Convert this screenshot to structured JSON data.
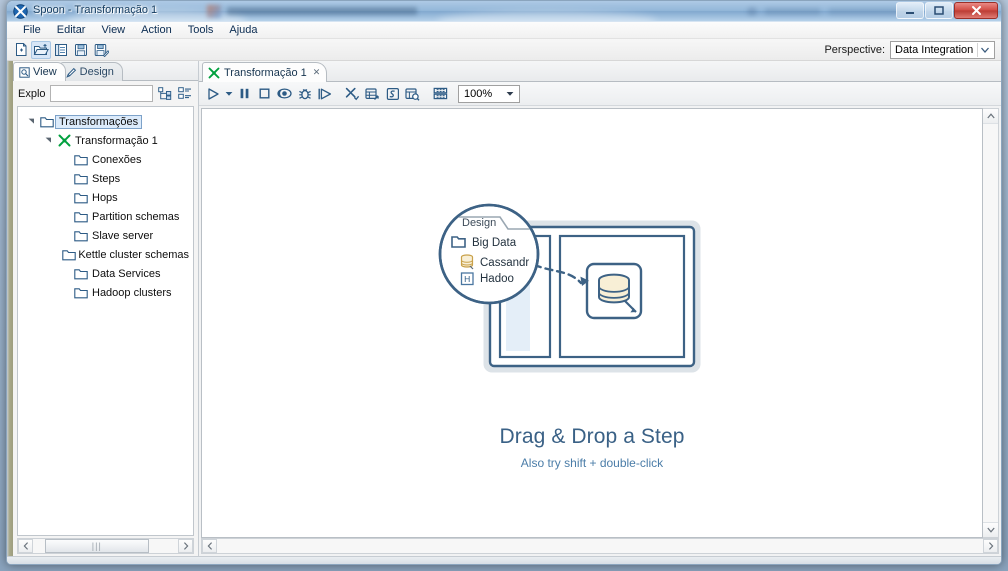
{
  "window": {
    "title": "Spoon - Transformação 1",
    "app_icon": "spoon-icon",
    "minimize_label": "Minimize",
    "maximize_label": "Maximize",
    "close_label": "Close"
  },
  "menubar": {
    "items": [
      {
        "label": "File",
        "name": "menu-file"
      },
      {
        "label": "Editar",
        "name": "menu-editar"
      },
      {
        "label": "View",
        "name": "menu-view"
      },
      {
        "label": "Action",
        "name": "menu-action"
      },
      {
        "label": "Tools",
        "name": "menu-tools"
      },
      {
        "label": "Ajuda",
        "name": "menu-ajuda"
      }
    ]
  },
  "toolbar": {
    "icons": [
      {
        "name": "new-file-icon",
        "title": "New"
      },
      {
        "name": "open-folder-icon",
        "title": "Open"
      },
      {
        "name": "list-icon",
        "title": "Explore"
      },
      {
        "name": "save-icon",
        "title": "Save"
      },
      {
        "name": "save-as-icon",
        "title": "Save as"
      }
    ],
    "perspective_label": "Perspective:",
    "perspective_value": "Data Integration"
  },
  "left_panel": {
    "tabs": [
      {
        "label": "View",
        "icon": "view-icon",
        "active": true
      },
      {
        "label": "Design",
        "icon": "pencil-icon",
        "active": false
      }
    ],
    "filter": {
      "label": "Explo",
      "value": "",
      "placeholder": "",
      "buttons": [
        {
          "name": "expand-all-icon"
        },
        {
          "name": "collapse-all-icon"
        }
      ]
    },
    "tree": [
      {
        "label": "Transformações",
        "depth": 0,
        "icon": "folder-icon",
        "twisty": "expanded",
        "selected": true
      },
      {
        "label": "Transformação 1",
        "depth": 1,
        "icon": "transformation-icon",
        "twisty": "expanded",
        "selected": false
      },
      {
        "label": "Conexões",
        "depth": 2,
        "icon": "folder-icon",
        "twisty": "none",
        "selected": false
      },
      {
        "label": "Steps",
        "depth": 2,
        "icon": "folder-icon",
        "twisty": "none",
        "selected": false
      },
      {
        "label": "Hops",
        "depth": 2,
        "icon": "folder-icon",
        "twisty": "none",
        "selected": false
      },
      {
        "label": "Partition schemas",
        "depth": 2,
        "icon": "folder-icon",
        "twisty": "none",
        "selected": false
      },
      {
        "label": "Slave server",
        "depth": 2,
        "icon": "folder-icon",
        "twisty": "none",
        "selected": false
      },
      {
        "label": "Kettle cluster schemas",
        "depth": 2,
        "icon": "folder-icon",
        "twisty": "none",
        "selected": false
      },
      {
        "label": "Data Services",
        "depth": 2,
        "icon": "folder-icon",
        "twisty": "none",
        "selected": false
      },
      {
        "label": "Hadoop clusters",
        "depth": 2,
        "icon": "folder-icon",
        "twisty": "none",
        "selected": false
      }
    ]
  },
  "editor": {
    "tab": {
      "label": "Transformação 1",
      "icon": "transformation-icon",
      "close_glyph": "✕"
    },
    "toolbar": {
      "icons": [
        {
          "name": "run-icon",
          "title": "Run"
        },
        {
          "name": "run-dropdown-icon",
          "title": "Run options"
        },
        {
          "name": "pause-icon",
          "title": "Pause"
        },
        {
          "name": "stop-icon",
          "title": "Stop"
        },
        {
          "name": "preview-icon",
          "title": "Preview"
        },
        {
          "name": "debug-icon",
          "title": "Debug"
        },
        {
          "name": "replay-icon",
          "title": "Replay"
        },
        {
          "name": "transformation-settings-icon",
          "title": "Transformation settings"
        },
        {
          "name": "show-execution-results-icon",
          "title": "Show execution results"
        },
        {
          "name": "sql-icon",
          "title": "SQL editor"
        },
        {
          "name": "inspect-data-icon",
          "title": "Inspect data"
        },
        {
          "name": "grid-align-icon",
          "title": "Align / arrange"
        }
      ],
      "zoom_value": "100%"
    },
    "canvas": {
      "hero_title": "Drag & Drop a Step",
      "hero_subtitle": "Also try shift + double-click",
      "magnifier": {
        "tab_label": "Design",
        "items": [
          {
            "label": "Big Data",
            "icon": "folder-icon"
          },
          {
            "label": "Cassandr",
            "icon": "cassandra-db-icon"
          },
          {
            "label": "Hadoo",
            "icon": "hadoop-h-icon"
          }
        ]
      },
      "dropped_step_icon": "database-step-icon"
    }
  },
  "colors": {
    "accent_blue": "#3a6186",
    "hero_sub_blue": "#4b7da8",
    "illustration_stroke": "#3d6285",
    "illustration_fill": "#f6ecd2",
    "tree_select_bg": "#dcebfb",
    "green_icon": "#00a03e",
    "title_text": "#123a5e"
  }
}
